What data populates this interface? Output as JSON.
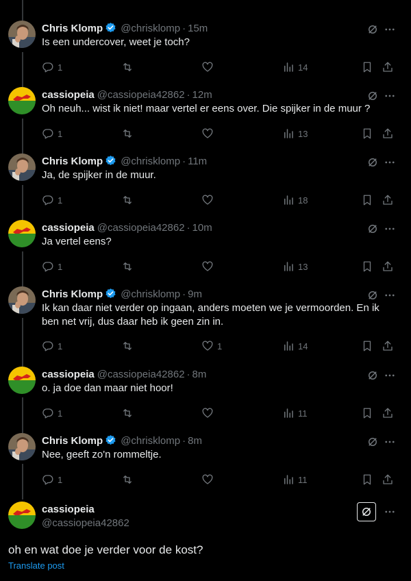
{
  "users": {
    "chris": {
      "name": "Chris Klomp",
      "handle": "@chrisklomp",
      "verified": true
    },
    "cassio": {
      "name": "cassiopeia",
      "handle": "@cassiopeia42862",
      "verified": false
    }
  },
  "tweets": [
    {
      "name": "Chris Klomp",
      "handle": "@chrisklomp",
      "time": "15m",
      "text": "Is een undercover, weet je toch?",
      "replies": "1",
      "likes": "",
      "views": "14"
    },
    {
      "name": "cassiopeia",
      "handle": "@cassiopeia42862",
      "time": "12m",
      "text": "Oh neuh... wist ik niet! maar vertel er eens over. Die spijker in de muur ?",
      "replies": "1",
      "likes": "",
      "views": "13"
    },
    {
      "name": "Chris Klomp",
      "handle": "@chrisklomp",
      "time": "11m",
      "text": "Ja, de spijker in de muur.",
      "replies": "1",
      "likes": "",
      "views": "18"
    },
    {
      "name": "cassiopeia",
      "handle": "@cassiopeia42862",
      "time": "10m",
      "text": "Ja vertel eens?",
      "replies": "1",
      "likes": "",
      "views": "13"
    },
    {
      "name": "Chris Klomp",
      "handle": "@chrisklomp",
      "time": "9m",
      "text": "Ik kan daar niet verder op ingaan, anders moeten we je vermoorden. En ik ben net vrij, dus daar heb ik geen zin in.",
      "replies": "1",
      "likes": "1",
      "views": "14"
    },
    {
      "name": "cassiopeia",
      "handle": "@cassiopeia42862",
      "time": "8m",
      "text": "o. ja doe dan maar niet hoor!",
      "replies": "1",
      "likes": "",
      "views": "11"
    },
    {
      "name": "Chris Klomp",
      "handle": "@chrisklomp",
      "time": "8m",
      "text": "Nee, geeft zo'n rommeltje.",
      "replies": "1",
      "likes": "",
      "views": "11"
    }
  ],
  "main_tweet": {
    "name": "cassiopeia",
    "handle": "@cassiopeia42862",
    "text": "oh en wat doe je verder voor de kost?",
    "translate_label": "Translate post"
  },
  "colors": {
    "accent": "#1d9bf0",
    "muted": "#71767b",
    "text": "#e7e9ea",
    "background": "#000000"
  },
  "icons": [
    "reply-icon",
    "retweet-icon",
    "like-icon",
    "views-icon",
    "bookmark-icon",
    "share-icon",
    "grok-icon",
    "more-icon",
    "verified-icon"
  ]
}
